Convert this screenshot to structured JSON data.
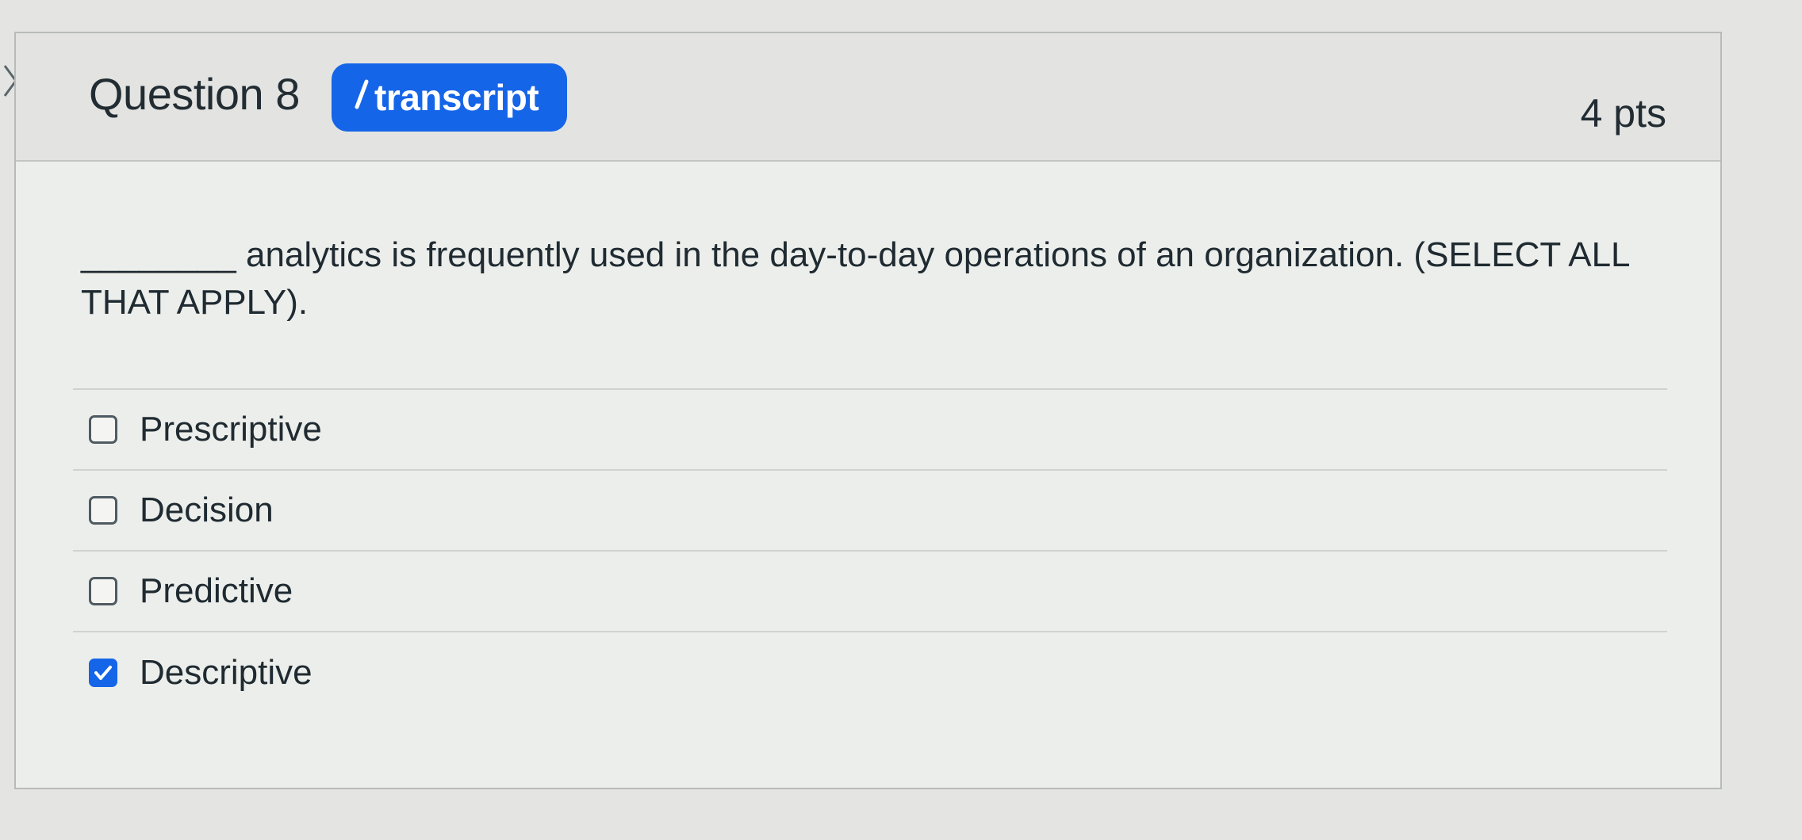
{
  "question": {
    "title": "Question 8",
    "badge_label": "transcript",
    "points": "4 pts",
    "prompt": "________ analytics is frequently used in the day-to-day operations of an organization. (SELECT ALL THAT APPLY)."
  },
  "options": [
    {
      "label": "Prescriptive",
      "checked": false
    },
    {
      "label": "Decision",
      "checked": false
    },
    {
      "label": "Predictive",
      "checked": false
    },
    {
      "label": "Descriptive",
      "checked": true
    }
  ],
  "colors": {
    "accent": "#1565e8",
    "card_background": "#eceeeb",
    "header_background": "#e3e4e1"
  },
  "icons": {
    "collapse": "chevron-right-icon",
    "badge": "slash-icon",
    "checked": "checkmark-icon"
  }
}
